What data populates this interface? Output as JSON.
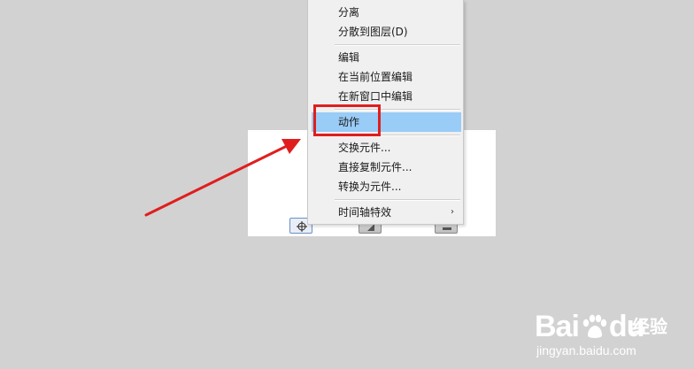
{
  "context_menu": {
    "items": [
      {
        "label": "分离"
      },
      {
        "label": "分散到图层(D)"
      },
      {
        "label": "编辑"
      },
      {
        "label": "在当前位置编辑"
      },
      {
        "label": "在新窗口中编辑"
      },
      {
        "label": "动作",
        "highlighted": true
      },
      {
        "label": "交换元件..."
      },
      {
        "label": "直接复制元件..."
      },
      {
        "label": "转换为元件..."
      },
      {
        "label": "时间轴特效",
        "submenu_arrow": "›"
      }
    ]
  },
  "stage": {
    "icons": [
      "crosshair-icon",
      "play-icon",
      "stop-icon"
    ]
  },
  "annotation": {
    "color": "#e01e1e"
  },
  "watermark": {
    "brand": "Bai",
    "brand_tail": "du",
    "product": "经验",
    "url": "jingyan.baidu.com"
  },
  "colors": {
    "background": "#d2d2d2",
    "menu_bg": "#f0f0f0",
    "menu_highlight": "#99ccf7"
  }
}
